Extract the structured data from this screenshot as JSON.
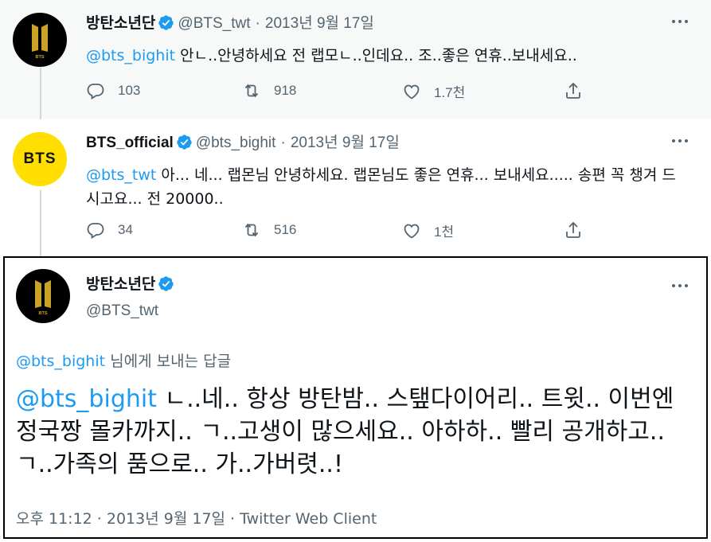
{
  "tweets": [
    {
      "name": "방탄소년단",
      "handle": "@BTS_twt",
      "dot": "·",
      "date": "2013년 9월 17일",
      "mention": "@bts_bighit",
      "text": " 안ㄴ..안녕하세요 전 랩모ㄴ..인데요.. 조..좋은 연휴..보내세요..",
      "replies": "103",
      "retweets": "918",
      "likes": "1.7천"
    },
    {
      "name": "BTS_official",
      "avatar_text": "BTS",
      "handle": "@bts_bighit",
      "dot": "·",
      "date": "2013년 9월 17일",
      "mention": "@bts_twt",
      "text": " 아... 네... 랩몬님 안녕하세요. 랩몬님도 좋은 연휴... 보내세요..... 송편 꼭 챙겨 드시고요... 전 20000..",
      "replies": "34",
      "retweets": "516",
      "likes": "1천"
    }
  ],
  "main_tweet": {
    "name": "방탄소년단",
    "handle": "@BTS_twt",
    "reply_mention": "@bts_bighit",
    "reply_text": " 님에게 보내는 답글",
    "mention": "@bts_bighit",
    "text": " ㄴ..네.. 항상 방탄밤.. 스탶다이어리.. 트윗.. 이번엔 정국짱 몰카까지.. ㄱ..고생이 많으세요.. 아하하.. 빨리 공개하고..ㄱ..가족의 품으로.. 가..가버렷..!",
    "meta": "오후 11:12 · 2013년 9월 17일 · Twitter Web Client"
  },
  "colors": {
    "accent": "#1d9bf0",
    "secondary_text": "#536471",
    "bts_yellow": "#ffde00",
    "logo_gold": "#c9a227"
  },
  "icons": [
    "verified-icon",
    "more-icon",
    "reply-icon",
    "retweet-icon",
    "like-icon",
    "share-icon",
    "bts-logo"
  ]
}
